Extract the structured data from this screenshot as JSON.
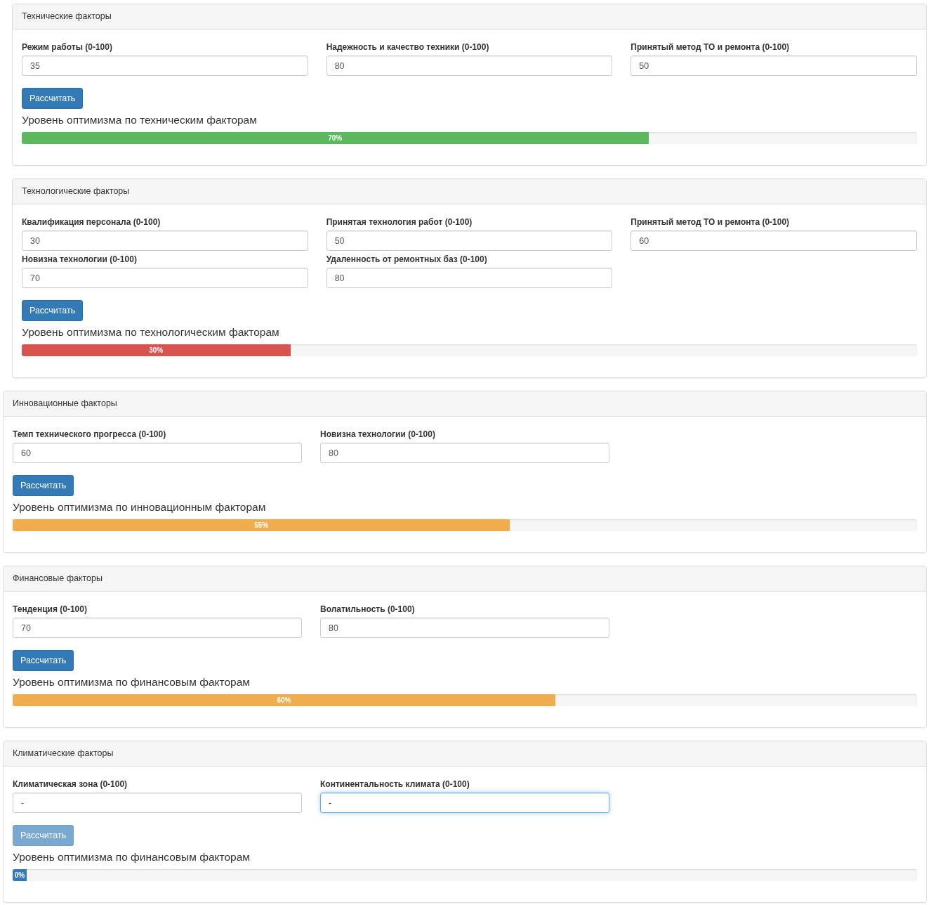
{
  "panels": [
    {
      "title": "Технические факторы",
      "fields": [
        {
          "label": "Режим работы (0-100)",
          "value": "35",
          "focused": false
        },
        {
          "label": "Надежность и качество техники (0-100)",
          "value": "80",
          "focused": false
        },
        {
          "label": "Принятый метод ТО и ремонта (0-100)",
          "value": "50",
          "focused": false
        }
      ],
      "button": {
        "label": "Рассчитать",
        "disabled": false
      },
      "result_title": "Уровень оптимизма по техническим факторам",
      "progress": {
        "kind": "success",
        "level": 0.7,
        "label": "70%"
      }
    },
    {
      "title": "Технологические факторы",
      "fields": [
        {
          "label": "Квалификация персонала (0-100)",
          "value": "30",
          "focused": false
        },
        {
          "label": "Принятая технология работ (0-100)",
          "value": "50",
          "focused": false
        },
        {
          "label": "Принятый метод ТО и ремонта (0-100)",
          "value": "60",
          "focused": false
        },
        {
          "label": "Новизна технологии (0-100)",
          "value": "70",
          "focused": false
        },
        {
          "label": "Удаленность от ремонтных баз (0-100)",
          "value": "80",
          "focused": false
        }
      ],
      "button": {
        "label": "Рассчитать",
        "disabled": false
      },
      "result_title": "Уровень оптимизма по технологическим факторам",
      "progress": {
        "kind": "danger",
        "level": 0.3,
        "label": "30%"
      }
    },
    {
      "title": "Инновационные факторы",
      "fields": [
        {
          "label": "Темп технического прогресса (0-100)",
          "value": "60",
          "focused": false
        },
        {
          "label": "Новизна технологии (0-100)",
          "value": "80",
          "focused": false
        }
      ],
      "button": {
        "label": "Рассчитать",
        "disabled": false
      },
      "result_title": "Уровень оптимизма по инновационным факторам",
      "progress": {
        "kind": "warning",
        "level": 0.55,
        "label": "55%"
      }
    },
    {
      "title": "Финансовые факторы",
      "fields": [
        {
          "label": "Тенденция (0-100)",
          "value": "70",
          "focused": false
        },
        {
          "label": "Волатильность (0-100)",
          "value": "80",
          "focused": false
        }
      ],
      "button": {
        "label": "Рассчитать",
        "disabled": false
      },
      "result_title": "Уровень оптимизма по финансовым факторам",
      "progress": {
        "kind": "warning",
        "level": 0.6,
        "label": "60%"
      }
    },
    {
      "title": "Климатические факторы",
      "fields": [
        {
          "label": "Климатическая зона (0-100)",
          "value": "-",
          "focused": false
        },
        {
          "label": "Континентальность климата (0-100)",
          "value": "-",
          "focused": true
        }
      ],
      "button": {
        "label": "Рассчитать",
        "disabled": true
      },
      "result_title": "Уровень оптимизма по финансовым факторам",
      "progress": {
        "kind": "primary",
        "level": 0,
        "label": "0%"
      }
    }
  ]
}
